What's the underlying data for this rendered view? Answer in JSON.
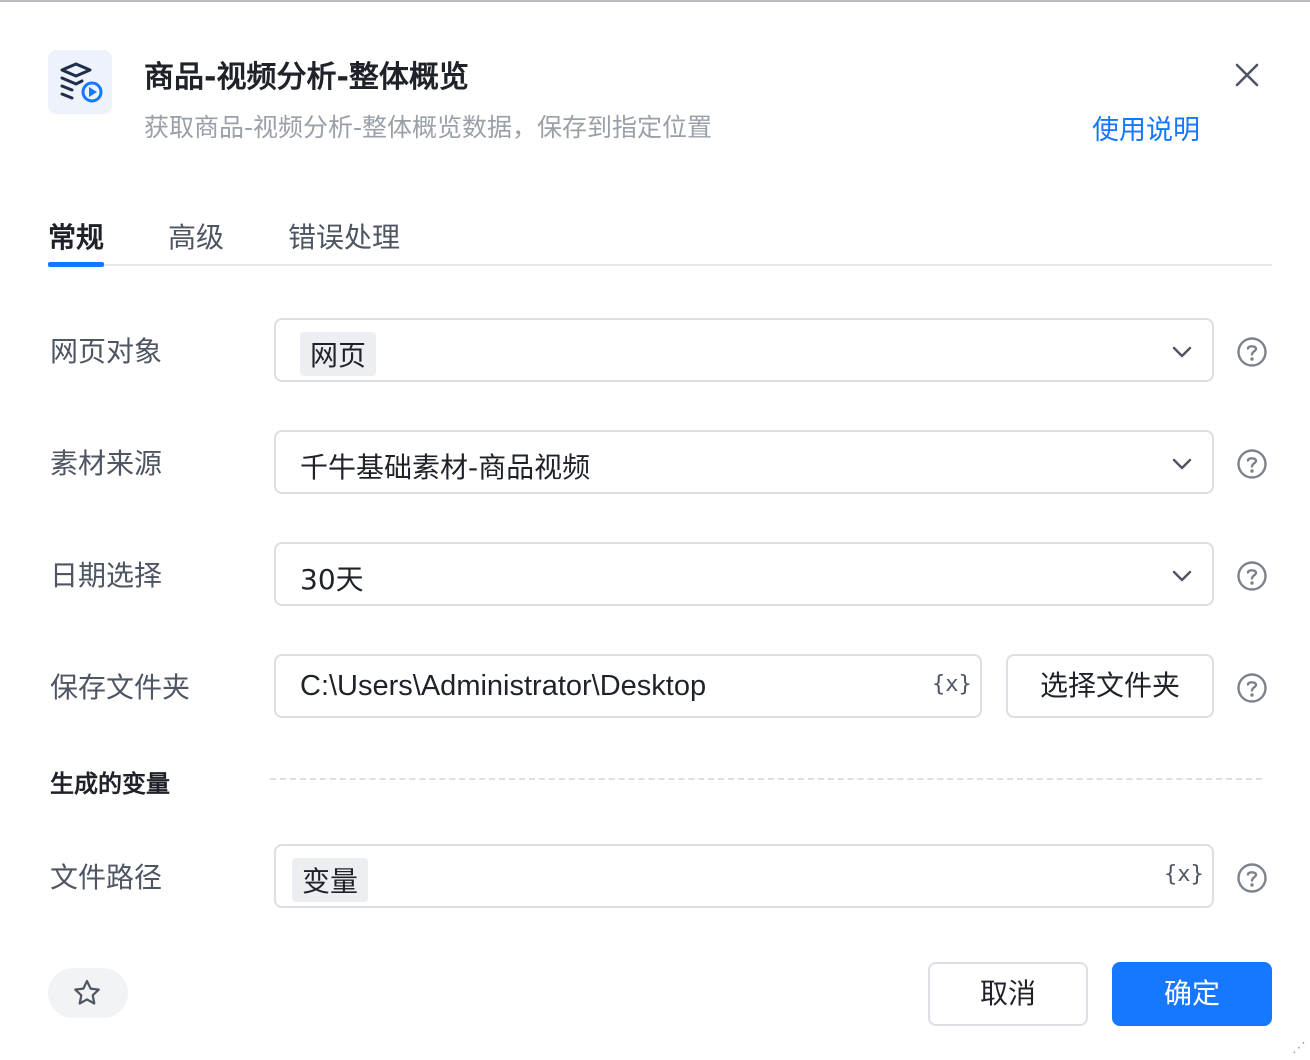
{
  "dialog": {
    "title": "商品-视频分析-整体概览",
    "subtitle": "获取商品-视频分析-整体概览数据，保存到指定位置",
    "help_link": "使用说明",
    "icon": "video-analysis-icon"
  },
  "tabs": [
    {
      "label": "常规",
      "active": true
    },
    {
      "label": "高级",
      "active": false
    },
    {
      "label": "错误处理",
      "active": false
    }
  ],
  "form": {
    "web_object": {
      "label": "网页对象",
      "value": "网页"
    },
    "material_source": {
      "label": "素材来源",
      "value": "千牛基础素材-商品视频"
    },
    "date_select": {
      "label": "日期选择",
      "value": "30天"
    },
    "save_folder": {
      "label": "保存文件夹",
      "value": "C:\\Users\\Administrator\\Desktop",
      "button": "选择文件夹"
    },
    "var_icon": "{x}"
  },
  "generated": {
    "section_title": "生成的变量",
    "file_path": {
      "label": "文件路径",
      "value": "变量"
    }
  },
  "footer": {
    "cancel": "取消",
    "confirm": "确定"
  },
  "colors": {
    "accent": "#1677ff",
    "border": "#dcdfe4",
    "muted_text": "#9aa0a8"
  }
}
